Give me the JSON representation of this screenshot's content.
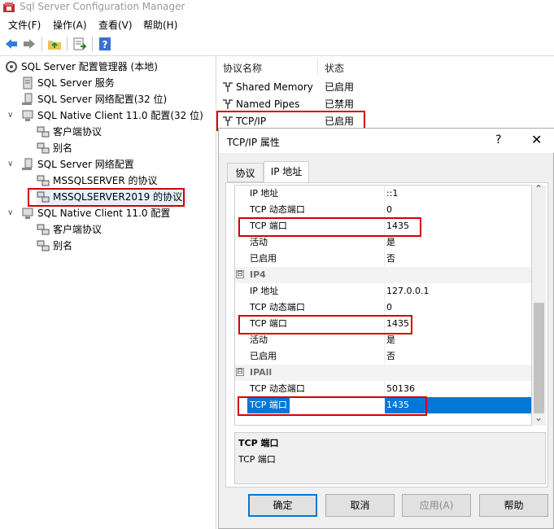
{
  "window": {
    "title": "Sql Server Configuration Manager"
  },
  "menu": [
    "文件(F)",
    "操作(A)",
    "查看(V)",
    "帮助(H)"
  ],
  "toolbar": {
    "icons": [
      "back-arrow-icon",
      "forward-arrow-icon",
      "folder-up-icon",
      "export-list-icon",
      "help-icon"
    ]
  },
  "tree": {
    "items": [
      {
        "label": "SQL Server 配置管理器 (本地)",
        "icon": "config-manager-icon",
        "level": 0
      },
      {
        "label": "SQL Server 服务",
        "icon": "services-icon",
        "level": 1
      },
      {
        "label": "SQL Server 网络配置(32 位)",
        "icon": "network-config-icon",
        "level": 1
      },
      {
        "label": "SQL Native Client 11.0 配置(32 位)",
        "icon": "client-config-icon",
        "level": 1,
        "expanded": true
      },
      {
        "label": "客户端协议",
        "icon": "protocol-icon",
        "level": 2
      },
      {
        "label": "别名",
        "icon": "alias-icon",
        "level": 2
      },
      {
        "label": "SQL Server 网络配置",
        "icon": "network-config-icon",
        "level": 1,
        "expanded": true
      },
      {
        "label": "MSSQLSERVER 的协议",
        "icon": "protocol-icon",
        "level": 2
      },
      {
        "label": "MSSQLSERVER2019 的协议",
        "icon": "protocol-icon",
        "level": 2,
        "highlighted": true
      },
      {
        "label": "SQL Native Client 11.0 配置",
        "icon": "client-config-icon",
        "level": 1,
        "expanded": true
      },
      {
        "label": "客户端协议",
        "icon": "protocol-icon",
        "level": 2
      },
      {
        "label": "别名",
        "icon": "alias-icon",
        "level": 2
      }
    ]
  },
  "protocols": {
    "headers": {
      "name": "协议名称",
      "status": "状态"
    },
    "rows": [
      {
        "name": "Shared Memory",
        "status": "已启用"
      },
      {
        "name": "Named Pipes",
        "status": "已禁用"
      },
      {
        "name": "TCP/IP",
        "status": "已启用",
        "highlighted": true
      }
    ]
  },
  "dialog": {
    "title": "TCP/IP 属性",
    "help": "?",
    "close": "✕",
    "tabs": [
      "协议",
      "IP 地址"
    ],
    "active_tab": "IP 地址",
    "grid_rows": [
      {
        "type": "prop",
        "name": "IP 地址",
        "value": "::1"
      },
      {
        "type": "prop",
        "name": "TCP 动态端口",
        "value": "0"
      },
      {
        "type": "prop",
        "name": "TCP 端口",
        "value": "1435",
        "highlighted": true
      },
      {
        "type": "prop",
        "name": "活动",
        "value": "是"
      },
      {
        "type": "prop",
        "name": "已启用",
        "value": "否"
      },
      {
        "type": "category",
        "name": "IP4",
        "toggle": "⊟"
      },
      {
        "type": "prop",
        "name": "IP 地址",
        "value": "127.0.0.1"
      },
      {
        "type": "prop",
        "name": "TCP 动态端口",
        "value": "0"
      },
      {
        "type": "prop",
        "name": "TCP 端口",
        "value": "1435",
        "highlighted": true
      },
      {
        "type": "prop",
        "name": "活动",
        "value": "是"
      },
      {
        "type": "prop",
        "name": "已启用",
        "value": "否"
      },
      {
        "type": "category",
        "name": "IPAll",
        "toggle": "⊟"
      },
      {
        "type": "prop",
        "name": "TCP 动态端口",
        "value": "50136"
      },
      {
        "type": "prop",
        "name": "TCP 端口",
        "value": "1435",
        "highlighted": true,
        "selected": true
      }
    ],
    "description": {
      "title": "TCP 端口",
      "text": "TCP 端口"
    },
    "buttons": {
      "ok": "确定",
      "cancel": "取消",
      "apply": "应用(A)",
      "help": "帮助"
    },
    "scroll": {
      "up": "⌃",
      "down": "⌄"
    }
  },
  "colors": {
    "highlight_box": "#d40000",
    "selection": "#0078d7"
  }
}
